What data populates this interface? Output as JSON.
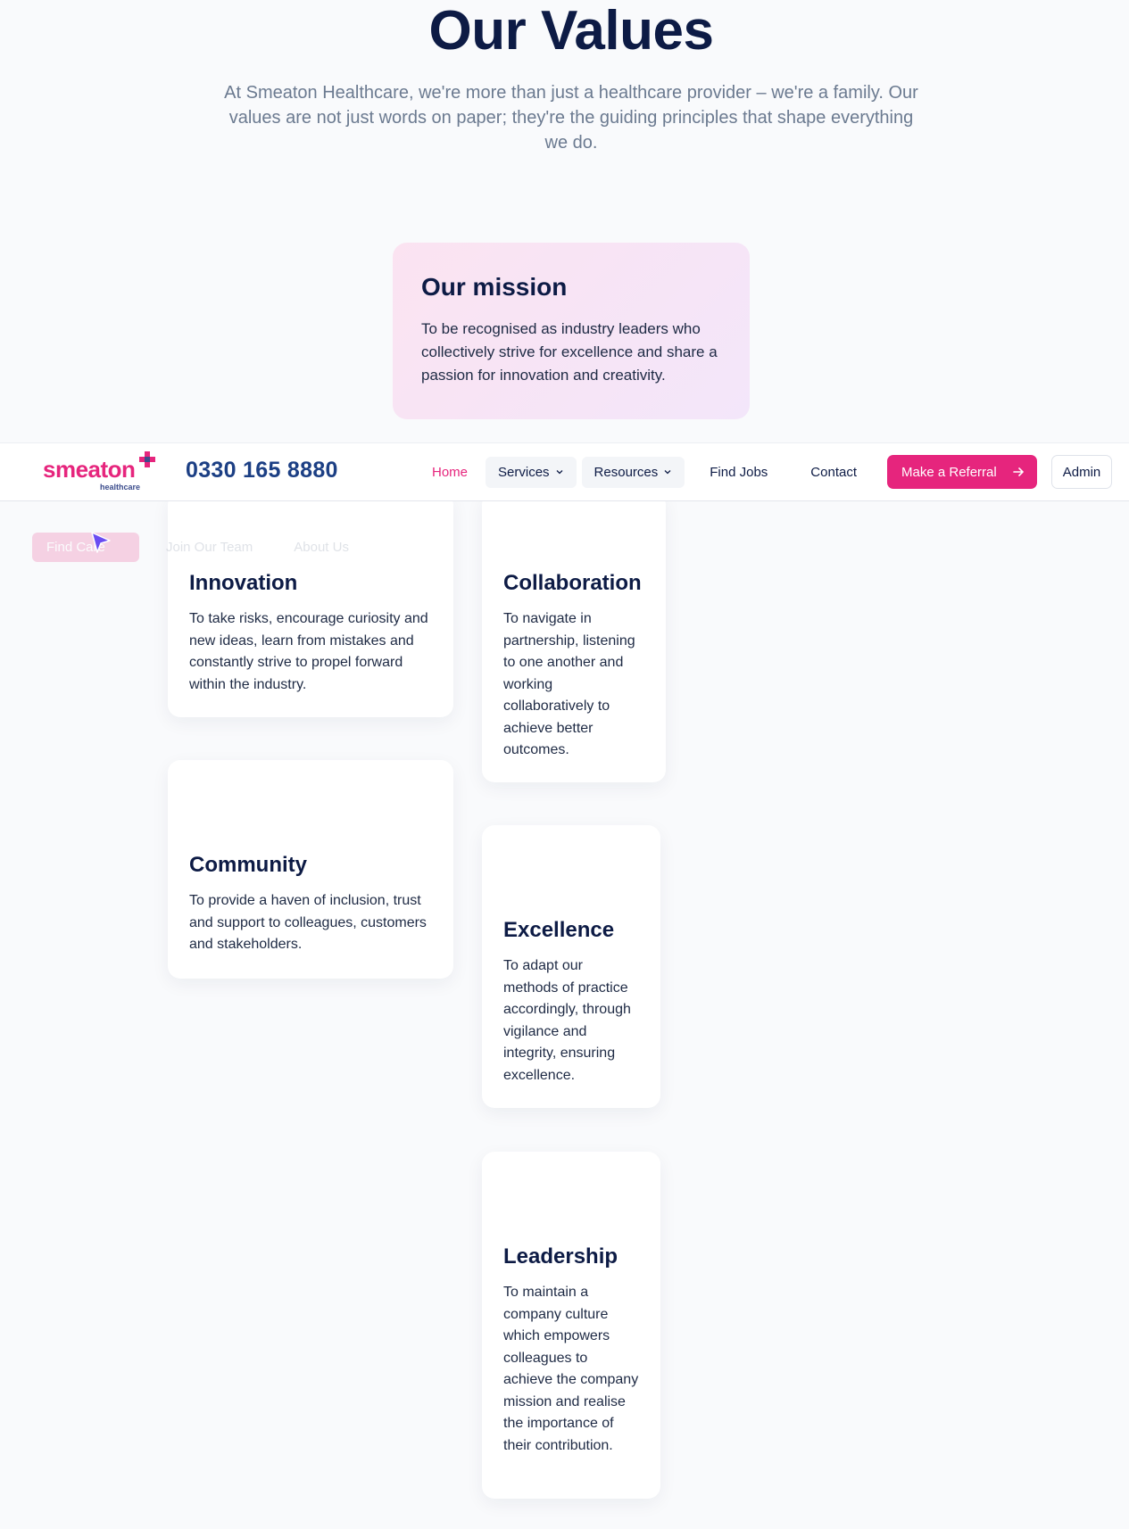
{
  "hero": {
    "title": "Our Values",
    "intro": "At Smeaton Healthcare, we're more than just a healthcare provider – we're a family. Our values are not just words on paper; they're the guiding principles that shape everything we do."
  },
  "mission": {
    "title": "Our mission",
    "text": "To be recognised as industry leaders who collectively strive for excellence and share a passion for innovation and creativity."
  },
  "values": {
    "innovation": {
      "title": "Innovation",
      "text": "To take risks, encourage curiosity and new ideas, learn from mistakes and constantly strive to propel forward within the industry."
    },
    "community": {
      "title": "Community",
      "text": "To provide a haven of inclusion, trust and support to colleagues, customers and stakeholders."
    },
    "collaboration": {
      "title": "Collaboration",
      "text": "To navigate in partnership, listening to one another and working collaboratively to achieve better outcomes."
    },
    "excellence": {
      "title": "Excellence",
      "text": "To adapt our methods of practice accordingly, through vigilance and integrity, ensuring excellence."
    },
    "leadership": {
      "title": "Leadership",
      "text": "To maintain a company culture which empowers colleagues to achieve the company mission and realise the importance of their contribution."
    }
  },
  "header": {
    "logo_text": "smeaton",
    "logo_sub": "healthcare",
    "phone": "0330 165 8880",
    "nav": {
      "home": "Home",
      "services": "Services",
      "resources": "Resources",
      "find_jobs": "Find Jobs",
      "contact": "Contact"
    },
    "referral_label": "Make a Referral",
    "admin_label": "Admin"
  },
  "subnav": {
    "find_care": "Find Care",
    "join_team": "Join Our Team",
    "about": "About Us"
  },
  "colors": {
    "brand_pink": "#e6257d",
    "navy": "#0d1b45",
    "phone_blue": "#1c3f84",
    "cursor_purple": "#6a4cf2"
  }
}
